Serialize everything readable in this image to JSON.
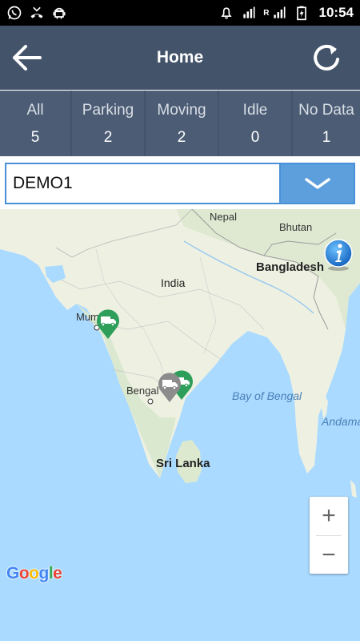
{
  "status_bar": {
    "time": "10:54",
    "signal_label": "R",
    "icons": [
      "whatsapp-icon",
      "missed-call-icon",
      "android-icon",
      "alarm-icon",
      "wifi-signal-icon",
      "cell-signal-icon",
      "battery-charging-icon"
    ]
  },
  "appbar": {
    "title": "Home"
  },
  "tabs": [
    {
      "label": "All",
      "count": "5"
    },
    {
      "label": "Parking",
      "count": "2"
    },
    {
      "label": "Moving",
      "count": "2"
    },
    {
      "label": "Idle",
      "count": "0"
    },
    {
      "label": "No Data",
      "count": "1"
    }
  ],
  "selector": {
    "value": "DEMO1"
  },
  "map": {
    "labels": {
      "nepal": "Nepal",
      "bhutan": "Bhutan",
      "bangladesh": "Bangladesh",
      "india": "India",
      "mumbai": "Mum",
      "bengaluru": "Bengal",
      "bay": "Bay of Bengal",
      "srilanka": "Sri Lanka",
      "andaman": "Andama"
    },
    "markers": [
      {
        "name": "Mumbai",
        "status": "moving",
        "color": "#2e9e5b"
      },
      {
        "name": "Chennai",
        "status": "moving",
        "color": "#2e9e5b"
      },
      {
        "name": "Bengaluru",
        "status": "parking",
        "color": "#8c8c8c"
      }
    ],
    "zoom_in": "+",
    "zoom_out": "−",
    "logo": {
      "G": "G",
      "o1": "o",
      "o2": "o",
      "g": "g",
      "l": "l",
      "e": "e"
    }
  },
  "colors": {
    "header": "#43536a",
    "tab": "#4b5c74",
    "accent": "#5d9fdd",
    "moving": "#2e9e5b",
    "parking": "#8c8c8c",
    "water": "#aadaff",
    "land": "#f2efe9"
  }
}
